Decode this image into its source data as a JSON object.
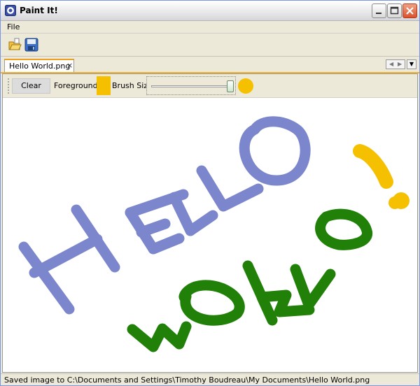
{
  "window": {
    "title": "Paint It!",
    "app_icon": "paint-app-icon",
    "controls": [
      "minimize-icon",
      "maximize-icon",
      "close-icon"
    ]
  },
  "menu": {
    "items": [
      {
        "label": "File"
      }
    ]
  },
  "toolbar": {
    "buttons": [
      {
        "name": "open-file-button",
        "icon": "open-folder-icon"
      },
      {
        "name": "save-file-button",
        "icon": "floppy-disk-icon"
      }
    ]
  },
  "tabs": [
    {
      "label": "Hello World.png",
      "active": true,
      "close_glyph": "×"
    }
  ],
  "tab_nav": {
    "left": "◀",
    "right": "▶",
    "dropdown": "▼"
  },
  "paint_toolbar": {
    "clear_label": "Clear",
    "foreground_label": "Foreground",
    "foreground_color": "#f5c000",
    "brush_size_label": "Brush Size",
    "brush_size_fraction": 0.97,
    "brush_preview_color": "#f5c000"
  },
  "canvas": {
    "strokes": [
      {
        "color": "#7b86cc",
        "label": "Hello"
      },
      {
        "color": "#208008",
        "label": "World"
      },
      {
        "color": "#f5c000",
        "label": "!"
      }
    ]
  },
  "status": {
    "text": "Saved image to C:\\Documents and Settings\\Timothy Boudreau\\My Documents\\Hello World.png"
  }
}
